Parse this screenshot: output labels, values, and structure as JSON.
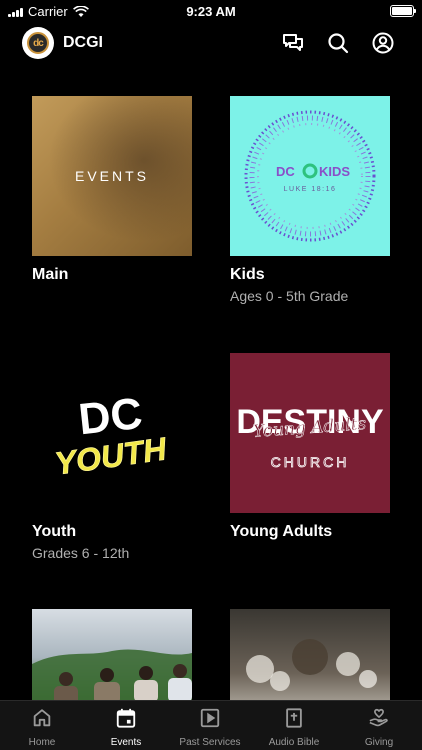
{
  "status_bar": {
    "carrier": "Carrier",
    "time": "9:23 AM"
  },
  "header": {
    "logo_text": "dc",
    "title": "DCGI",
    "icons": [
      "chat-icon",
      "search-icon",
      "account-icon"
    ]
  },
  "cards": [
    {
      "title": "Main",
      "subtitle": "",
      "thumb_text": "EVENTS"
    },
    {
      "title": "Kids",
      "subtitle": "Ages 0 - 5th Grade",
      "thumb_text": [
        "DC",
        "KIDS",
        "LUKE 18:16"
      ]
    },
    {
      "title": "Youth",
      "subtitle": "Grades 6 - 12th",
      "thumb_text": [
        "DC",
        "YOUTH"
      ]
    },
    {
      "title": "Young Adults",
      "subtitle": "",
      "thumb_text": [
        "DESTINY",
        "Young Adults",
        "CHURCH"
      ]
    },
    {
      "title": "",
      "subtitle": ""
    },
    {
      "title": "",
      "subtitle": ""
    }
  ],
  "tabs": [
    {
      "label": "Home",
      "icon": "home-icon",
      "active": false
    },
    {
      "label": "Events",
      "icon": "calendar-icon",
      "active": true
    },
    {
      "label": "Past Services",
      "icon": "play-icon",
      "active": false
    },
    {
      "label": "Audio Bible",
      "icon": "bible-icon",
      "active": false
    },
    {
      "label": "Giving",
      "icon": "giving-icon",
      "active": false
    }
  ],
  "colors": {
    "background": "#000000",
    "tabbar": "#141414",
    "kids_bg": "#7df2e8",
    "young_adults_bg": "#7a1f34"
  }
}
